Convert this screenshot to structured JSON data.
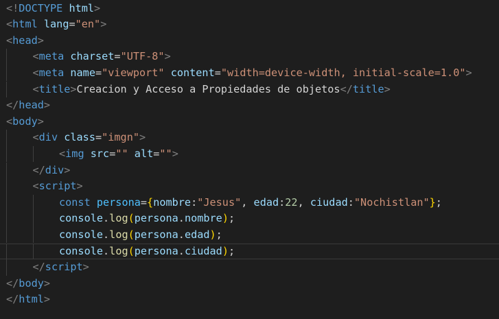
{
  "editor": {
    "lines": [
      {
        "indent": 0,
        "tokens": [
          {
            "t": "<!",
            "c": "pn"
          },
          {
            "t": "DOCTYPE",
            "c": "tag"
          },
          {
            "t": " ",
            "c": "txt"
          },
          {
            "t": "html",
            "c": "attr"
          },
          {
            "t": ">",
            "c": "pn"
          }
        ]
      },
      {
        "indent": 0,
        "tokens": [
          {
            "t": "<",
            "c": "pn"
          },
          {
            "t": "html",
            "c": "tag"
          },
          {
            "t": " ",
            "c": "txt"
          },
          {
            "t": "lang",
            "c": "attr"
          },
          {
            "t": "=",
            "c": "txt"
          },
          {
            "t": "\"en\"",
            "c": "str"
          },
          {
            "t": ">",
            "c": "pn"
          }
        ]
      },
      {
        "indent": 0,
        "tokens": [
          {
            "t": "<",
            "c": "pn"
          },
          {
            "t": "head",
            "c": "tag"
          },
          {
            "t": ">",
            "c": "pn"
          }
        ]
      },
      {
        "indent": 1,
        "tokens": [
          {
            "t": "<",
            "c": "pn"
          },
          {
            "t": "meta",
            "c": "tag"
          },
          {
            "t": " ",
            "c": "txt"
          },
          {
            "t": "charset",
            "c": "attr"
          },
          {
            "t": "=",
            "c": "txt"
          },
          {
            "t": "\"UTF-8\"",
            "c": "str"
          },
          {
            "t": ">",
            "c": "pn"
          }
        ]
      },
      {
        "indent": 1,
        "tokens": [
          {
            "t": "<",
            "c": "pn"
          },
          {
            "t": "meta",
            "c": "tag"
          },
          {
            "t": " ",
            "c": "txt"
          },
          {
            "t": "name",
            "c": "attr"
          },
          {
            "t": "=",
            "c": "txt"
          },
          {
            "t": "\"viewport\"",
            "c": "str"
          },
          {
            "t": " ",
            "c": "txt"
          },
          {
            "t": "content",
            "c": "attr"
          },
          {
            "t": "=",
            "c": "txt"
          },
          {
            "t": "\"width=device-width, initial-scale=1.0\"",
            "c": "str"
          },
          {
            "t": ">",
            "c": "pn"
          }
        ]
      },
      {
        "indent": 1,
        "tokens": [
          {
            "t": "<",
            "c": "pn"
          },
          {
            "t": "title",
            "c": "tag"
          },
          {
            "t": ">",
            "c": "pn"
          },
          {
            "t": "Creacion y Acceso a Propiedades de objetos",
            "c": "txt"
          },
          {
            "t": "</",
            "c": "pn"
          },
          {
            "t": "title",
            "c": "tag"
          },
          {
            "t": ">",
            "c": "pn"
          }
        ]
      },
      {
        "indent": 0,
        "tokens": [
          {
            "t": "</",
            "c": "pn"
          },
          {
            "t": "head",
            "c": "tag"
          },
          {
            "t": ">",
            "c": "pn"
          }
        ]
      },
      {
        "indent": 0,
        "tokens": [
          {
            "t": "<",
            "c": "pn"
          },
          {
            "t": "body",
            "c": "tag"
          },
          {
            "t": ">",
            "c": "pn"
          }
        ]
      },
      {
        "indent": 1,
        "tokens": [
          {
            "t": "<",
            "c": "pn"
          },
          {
            "t": "div",
            "c": "tag"
          },
          {
            "t": " ",
            "c": "txt"
          },
          {
            "t": "class",
            "c": "attr"
          },
          {
            "t": "=",
            "c": "txt"
          },
          {
            "t": "\"imgn\"",
            "c": "str"
          },
          {
            "t": ">",
            "c": "pn"
          }
        ]
      },
      {
        "indent": 2,
        "tokens": [
          {
            "t": "<",
            "c": "pn"
          },
          {
            "t": "img",
            "c": "tag"
          },
          {
            "t": " ",
            "c": "txt"
          },
          {
            "t": "src",
            "c": "attr"
          },
          {
            "t": "=",
            "c": "txt"
          },
          {
            "t": "\"\"",
            "c": "str"
          },
          {
            "t": " ",
            "c": "txt"
          },
          {
            "t": "alt",
            "c": "attr"
          },
          {
            "t": "=",
            "c": "txt"
          },
          {
            "t": "\"\"",
            "c": "str"
          },
          {
            "t": ">",
            "c": "pn"
          }
        ]
      },
      {
        "indent": 1,
        "tokens": [
          {
            "t": "</",
            "c": "pn"
          },
          {
            "t": "div",
            "c": "tag"
          },
          {
            "t": ">",
            "c": "pn"
          }
        ]
      },
      {
        "indent": 1,
        "tokens": [
          {
            "t": "<",
            "c": "pn"
          },
          {
            "t": "script",
            "c": "tag"
          },
          {
            "t": ">",
            "c": "pn"
          }
        ]
      },
      {
        "indent": 2,
        "tokens": [
          {
            "t": "const",
            "c": "kw"
          },
          {
            "t": " ",
            "c": "txt"
          },
          {
            "t": "persona",
            "c": "var"
          },
          {
            "t": "=",
            "c": "txt"
          },
          {
            "t": "{",
            "c": "br1"
          },
          {
            "t": "nombre",
            "c": "prop"
          },
          {
            "t": ":",
            "c": "txt"
          },
          {
            "t": "\"Jesus\"",
            "c": "str"
          },
          {
            "t": ", ",
            "c": "txt"
          },
          {
            "t": "edad",
            "c": "prop"
          },
          {
            "t": ":",
            "c": "txt"
          },
          {
            "t": "22",
            "c": "num"
          },
          {
            "t": ", ",
            "c": "txt"
          },
          {
            "t": "ciudad",
            "c": "prop"
          },
          {
            "t": ":",
            "c": "txt"
          },
          {
            "t": "\"Nochistlan\"",
            "c": "str"
          },
          {
            "t": "}",
            "c": "br1"
          },
          {
            "t": ";",
            "c": "txt"
          }
        ]
      },
      {
        "indent": 2,
        "tokens": [
          {
            "t": "console",
            "c": "prop"
          },
          {
            "t": ".",
            "c": "txt"
          },
          {
            "t": "log",
            "c": "fn"
          },
          {
            "t": "(",
            "c": "br1"
          },
          {
            "t": "persona",
            "c": "prop"
          },
          {
            "t": ".",
            "c": "txt"
          },
          {
            "t": "nombre",
            "c": "prop"
          },
          {
            "t": ")",
            "c": "br1"
          },
          {
            "t": ";",
            "c": "txt"
          }
        ]
      },
      {
        "indent": 2,
        "tokens": [
          {
            "t": "console",
            "c": "prop"
          },
          {
            "t": ".",
            "c": "txt"
          },
          {
            "t": "log",
            "c": "fn"
          },
          {
            "t": "(",
            "c": "br1"
          },
          {
            "t": "persona",
            "c": "prop"
          },
          {
            "t": ".",
            "c": "txt"
          },
          {
            "t": "edad",
            "c": "prop"
          },
          {
            "t": ")",
            "c": "br1"
          },
          {
            "t": ";",
            "c": "txt"
          }
        ]
      },
      {
        "indent": 2,
        "current": true,
        "tokens": [
          {
            "t": "console",
            "c": "prop"
          },
          {
            "t": ".",
            "c": "txt"
          },
          {
            "t": "log",
            "c": "fn"
          },
          {
            "t": "(",
            "c": "br1"
          },
          {
            "t": "persona",
            "c": "prop"
          },
          {
            "t": ".",
            "c": "txt"
          },
          {
            "t": "ciudad",
            "c": "prop"
          },
          {
            "t": ")",
            "c": "br1"
          },
          {
            "t": ";",
            "c": "txt"
          }
        ]
      },
      {
        "indent": 1,
        "tokens": [
          {
            "t": "</",
            "c": "pn"
          },
          {
            "t": "script",
            "c": "tag"
          },
          {
            "t": ">",
            "c": "pn"
          }
        ]
      },
      {
        "indent": 0,
        "tokens": [
          {
            "t": "</",
            "c": "pn"
          },
          {
            "t": "body",
            "c": "tag"
          },
          {
            "t": ">",
            "c": "pn"
          }
        ]
      },
      {
        "indent": 0,
        "tokens": [
          {
            "t": "</",
            "c": "pn"
          },
          {
            "t": "html",
            "c": "tag"
          },
          {
            "t": ">",
            "c": "pn"
          }
        ]
      }
    ]
  }
}
